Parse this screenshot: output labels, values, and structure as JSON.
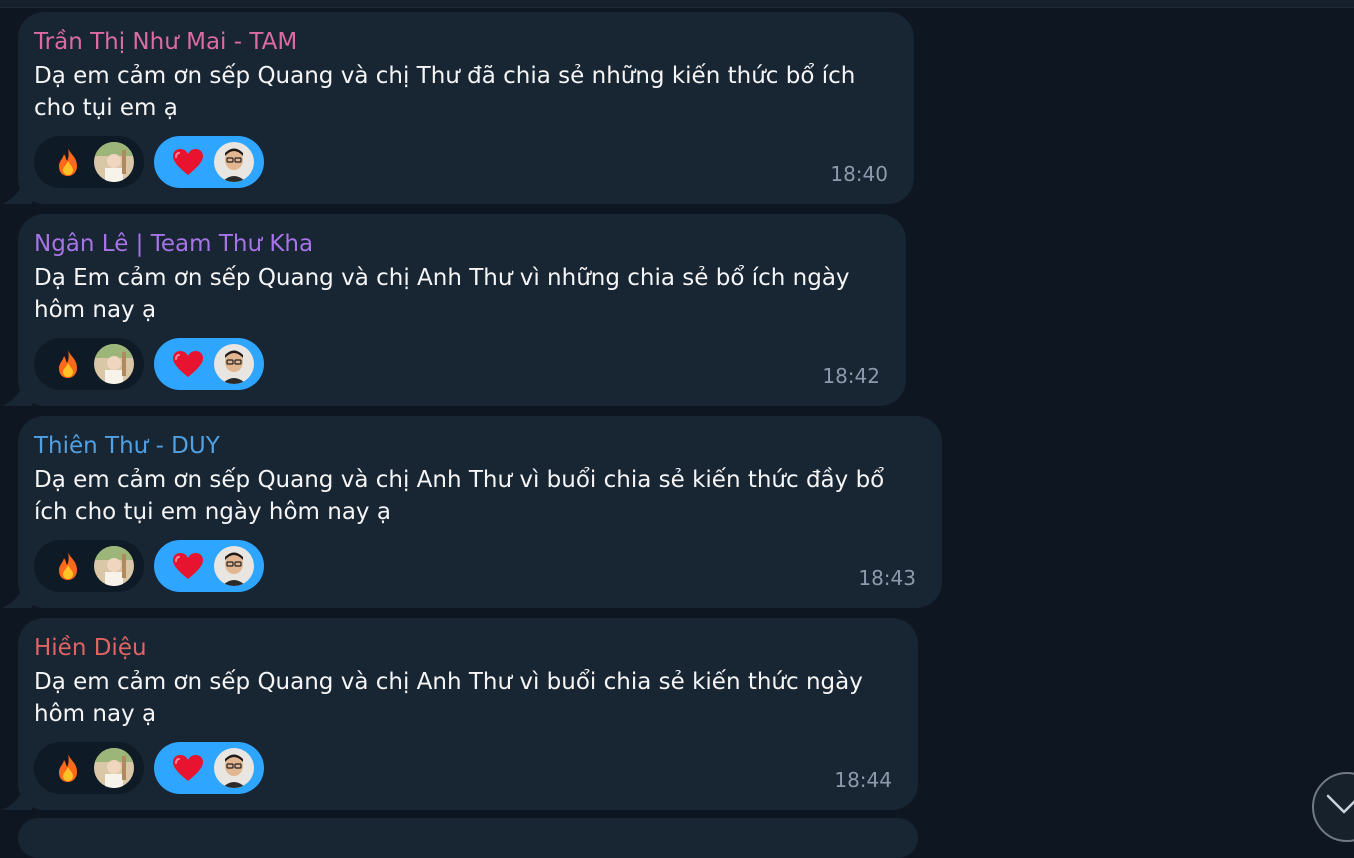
{
  "messages": [
    {
      "sender": "Trần Thị Như Mai - TAM",
      "sender_color": "#dd6ba3",
      "text": "Dạ em cảm ơn sếp Quang và chị Thư đã chia sẻ những kiến thức bổ ích cho tụi em ạ",
      "time": "18:40",
      "reactions": [
        {
          "emoji": "fire-icon",
          "selected": false
        },
        {
          "emoji": "heart-icon",
          "selected": true
        }
      ]
    },
    {
      "sender": "Ngân Lê | Team Thư Kha",
      "sender_color": "#a774e8",
      "text": "Dạ Em cảm ơn sếp Quang và chị Anh Thư vì những chia sẻ bổ ích ngày hôm nay ạ",
      "time": "18:42",
      "reactions": [
        {
          "emoji": "fire-icon",
          "selected": false
        },
        {
          "emoji": "heart-icon",
          "selected": true
        }
      ]
    },
    {
      "sender": "Thiên Thư - DUY",
      "sender_color": "#4fa1e3",
      "text": "Dạ em cảm ơn sếp Quang và chị Anh Thư vì buổi chia sẻ kiến thức đầy bổ ích cho tụi em ngày hôm nay ạ",
      "time": "18:43",
      "reactions": [
        {
          "emoji": "fire-icon",
          "selected": false
        },
        {
          "emoji": "heart-icon",
          "selected": true
        }
      ]
    },
    {
      "sender": "Hiền Diệu",
      "sender_color": "#e06464",
      "text": "Dạ em cảm ơn sếp Quang và chị Anh Thư vì buổi chia sẻ kiến thức ngày hôm nay ạ",
      "time": "18:44",
      "reactions": [
        {
          "emoji": "fire-icon",
          "selected": false
        },
        {
          "emoji": "heart-icon",
          "selected": true
        }
      ]
    }
  ],
  "colors": {
    "background": "#0e1621",
    "bubble": "#182533",
    "heart_reaction_bg": "#2ea6ff",
    "time_text": "#8b9bab"
  },
  "icons": {
    "scroll_down": "chevron-down-icon"
  }
}
